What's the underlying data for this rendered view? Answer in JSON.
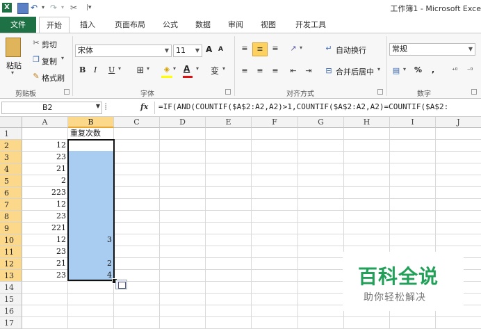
{
  "window": {
    "title": "工作簿1 - Microsoft Exce"
  },
  "tabs": [
    "文件",
    "开始",
    "插入",
    "页面布局",
    "公式",
    "数据",
    "审阅",
    "视图",
    "开发工具"
  ],
  "ribbon": {
    "clipboard": {
      "paste": "粘贴",
      "cut": "剪切",
      "copy": "复制",
      "format_painter": "格式刷",
      "label": "剪贴板"
    },
    "font": {
      "name": "宋体",
      "size": "11",
      "bold": "B",
      "italic": "I",
      "underline": "U",
      "grow": "A",
      "shrink": "A",
      "label": "字体",
      "phonetic": "变"
    },
    "alignment": {
      "wrap": "自动换行",
      "merge": "合并后居中",
      "label": "对齐方式"
    },
    "number": {
      "format": "常规",
      "percent": "%",
      "comma": ",",
      "label": "数字"
    }
  },
  "formula_bar": {
    "name_box": "B2",
    "fx": "fx",
    "formula": "=IF(AND(COUNTIF($A$2:A2,A2)>1,COUNTIF($A$2:A2,A2)=COUNTIF($A$2:"
  },
  "sheet": {
    "columns": [
      "A",
      "B",
      "C",
      "D",
      "E",
      "F",
      "G",
      "H",
      "I",
      "J"
    ],
    "rows": [
      "1",
      "2",
      "3",
      "4",
      "5",
      "6",
      "7",
      "8",
      "9",
      "10",
      "11",
      "12",
      "13",
      "14",
      "15",
      "16",
      "17"
    ],
    "header_b1": "重复次数",
    "col_a": [
      "12",
      "23",
      "21",
      "2",
      "223",
      "12",
      "23",
      "221",
      "12",
      "23",
      "21",
      "23"
    ],
    "col_b": [
      "",
      "",
      "",
      "",
      "",
      "",
      "",
      "",
      "3",
      "",
      "2",
      "4"
    ]
  },
  "watermark": {
    "title": "百科全说",
    "subtitle": "助你轻松解决"
  },
  "colors": {
    "file_tab": "#1e7145",
    "selection": "#a9cdf0",
    "header_highlight": "#fbd88a",
    "watermark": "#22a05a"
  }
}
